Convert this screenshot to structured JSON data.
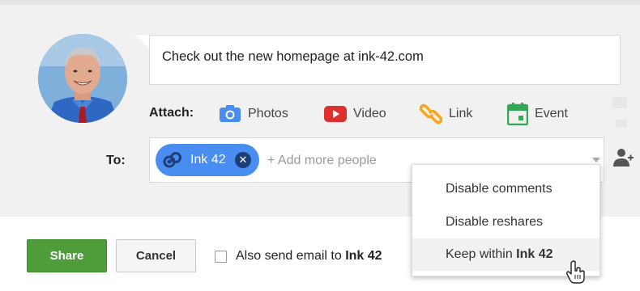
{
  "post": {
    "text": "Check out the new homepage at ink-42.com"
  },
  "attach": {
    "label": "Attach:",
    "items": [
      {
        "label": "Photos",
        "icon": "camera-icon",
        "color": "#4a8df0"
      },
      {
        "label": "Video",
        "icon": "video-icon",
        "color": "#e02f2f"
      },
      {
        "label": "Link",
        "icon": "link-icon",
        "color": "#f5a623"
      },
      {
        "label": "Event",
        "icon": "calendar-icon",
        "color": "#34a853"
      }
    ]
  },
  "to": {
    "label": "To:",
    "chip_label": "Ink 42",
    "add_placeholder": "+ Add more people"
  },
  "menu": {
    "items": [
      {
        "label": "Disable comments"
      },
      {
        "label": "Disable reshares"
      },
      {
        "label_prefix": "Keep within ",
        "label_bold": "Ink 42",
        "highlighted": true
      }
    ]
  },
  "actions": {
    "share_label": "Share",
    "cancel_label": "Cancel",
    "email_prefix": "Also send email to ",
    "email_target": "Ink 42",
    "email_checked": false
  },
  "colors": {
    "share_green": "#4f9c3a",
    "chip_blue": "#4a8df0",
    "panel_bg": "#f1f1f1"
  }
}
